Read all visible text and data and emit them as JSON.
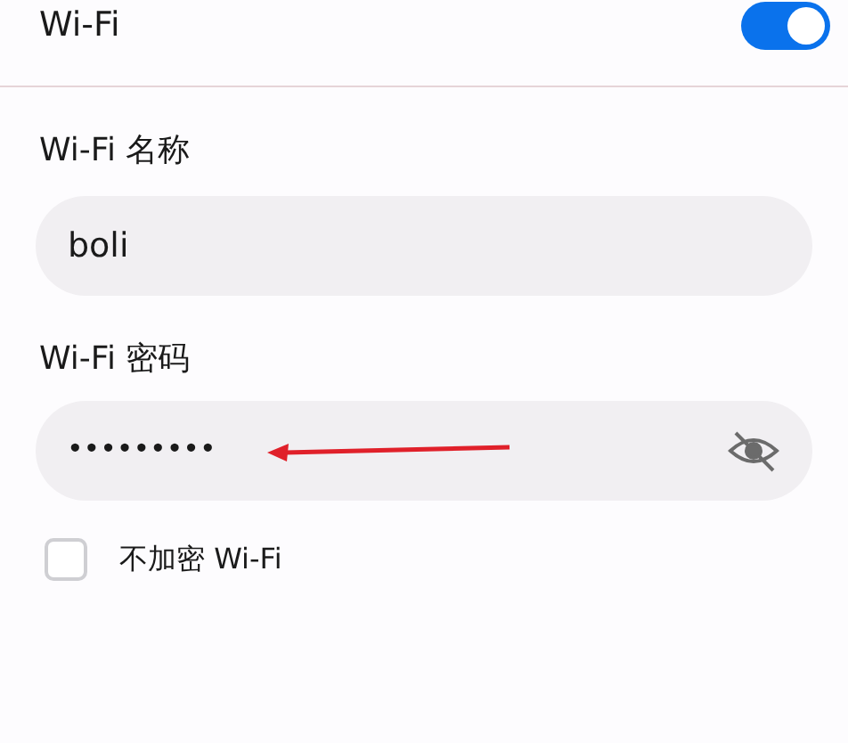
{
  "wifi_toggle": {
    "label": "Wi-Fi",
    "on": true
  },
  "name_field": {
    "label": "Wi-Fi 名称",
    "value": "boli"
  },
  "password_field": {
    "label": "Wi-Fi 密码",
    "value": "•••••••••",
    "visible": false
  },
  "no_encryption": {
    "label": "不加密 Wi-Fi",
    "checked": false
  }
}
